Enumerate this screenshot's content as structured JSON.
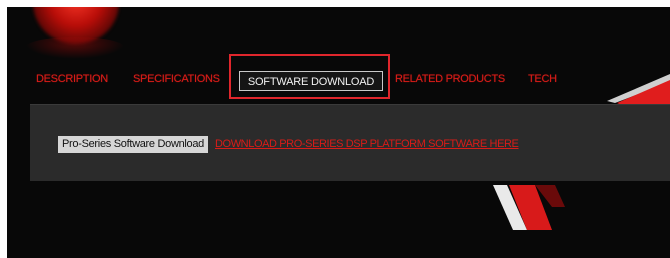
{
  "tabs": [
    {
      "label": "DESCRIPTION"
    },
    {
      "label": "SPECIFICATIONS"
    },
    {
      "label": "SOFTWARE DOWNLOAD",
      "active": true
    },
    {
      "label": "RELATED PRODUCTS"
    },
    {
      "label": "TECH"
    }
  ],
  "download": {
    "label": "Pro-Series Software Download",
    "link_text": "DOWNLOAD PRO-SERIES DSP PLATFORM SOFTWARE HERE"
  },
  "colors": {
    "accent_red": "#d81c18",
    "highlight": "#e0262c",
    "background": "#080808",
    "panel": "#2b2b2b"
  },
  "icons": {
    "logo": "brand-logo-icon"
  }
}
